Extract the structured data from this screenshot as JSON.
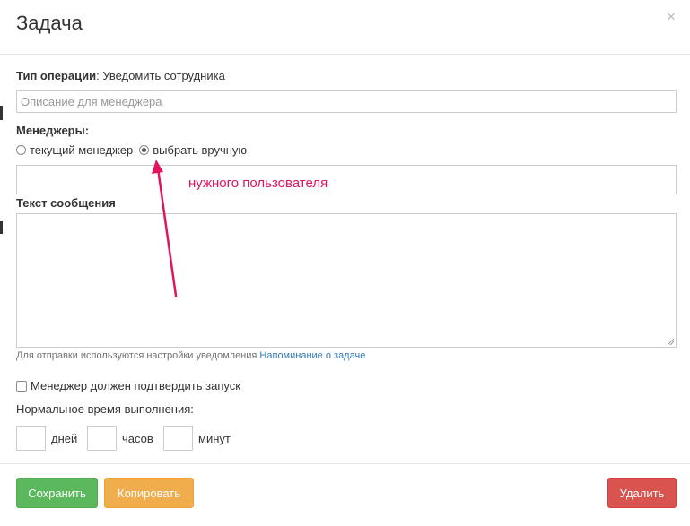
{
  "dialog": {
    "title": "Задача",
    "close_glyph": "×"
  },
  "operation": {
    "label": "Тип операции",
    "separator": ": ",
    "value": "Уведомить сотрудника"
  },
  "description": {
    "placeholder": "Описание для менеджера",
    "value": ""
  },
  "managers": {
    "label": "Менеджеры:",
    "options": [
      {
        "label": "текущий менеджер",
        "checked": false
      },
      {
        "label": "выбрать вручную",
        "checked": true
      }
    ],
    "selected_value": ""
  },
  "annotation": {
    "text": "нужного пользователя",
    "color": "#e0145f"
  },
  "message": {
    "label": "Текст сообщения",
    "value": "",
    "hint_prefix": "Для отправки используются настройки уведомления ",
    "hint_link": "Напоминание о задаче"
  },
  "confirm": {
    "label": "Менеджер должен подтвердить запуск",
    "checked": false
  },
  "normal_time": {
    "label": "Нормальное время выполнения:",
    "units": [
      "дней",
      "часов",
      "минут"
    ],
    "values": [
      "",
      "",
      ""
    ]
  },
  "buttons": {
    "save": "Сохранить",
    "copy": "Копировать",
    "delete": "Удалить"
  },
  "colors": {
    "save": "#5cb85c",
    "copy": "#f0ad4e",
    "delete": "#d9534f",
    "link": "#337ab7"
  }
}
